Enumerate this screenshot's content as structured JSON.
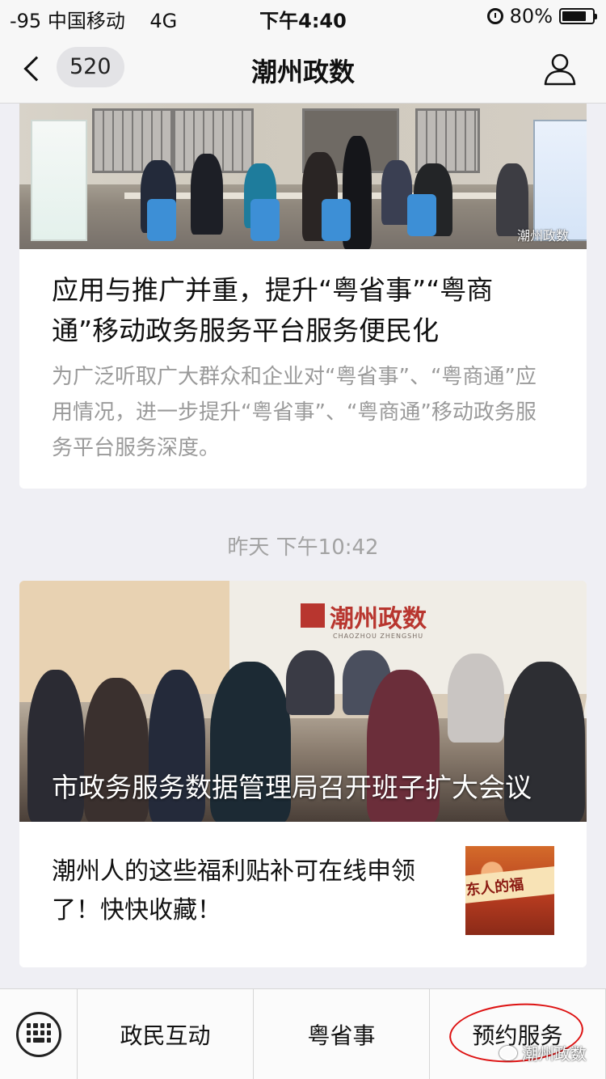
{
  "status_bar": {
    "signal_carrier": "-95 中国移动",
    "network": "4G",
    "time": "下午4:40",
    "battery_percent": "80%",
    "battery_level": 0.8
  },
  "nav": {
    "unread_count": "520",
    "title": "潮州政数"
  },
  "articles": [
    {
      "title": "应用与推广并重，提升“粤省事”“粤商通”移动政务服务平台服务便民化",
      "description": "为广泛听取广大群众和企业对“粤省事”、“粤商通”应用情况，进一步提升“粤省事”、“粤商通”移动政务服务平台服务深度。",
      "image_watermark": "潮州政数"
    }
  ],
  "timestamp": "昨天 下午10:42",
  "article_group": {
    "main_title": "市政务服务数据管理局召开班子扩大会议",
    "logo_text": "潮州政数",
    "logo_subtext": "CHAOZHOU ZHENGSHU",
    "sub_items": [
      {
        "title": "潮州人的这些福利贴补可在线申领了！快快收藏！",
        "thumb_text": "东人的福"
      }
    ]
  },
  "bottom_menu": {
    "items": [
      "政民互动",
      "粤省事",
      "预约服务"
    ],
    "watermark": "潮州政数"
  }
}
